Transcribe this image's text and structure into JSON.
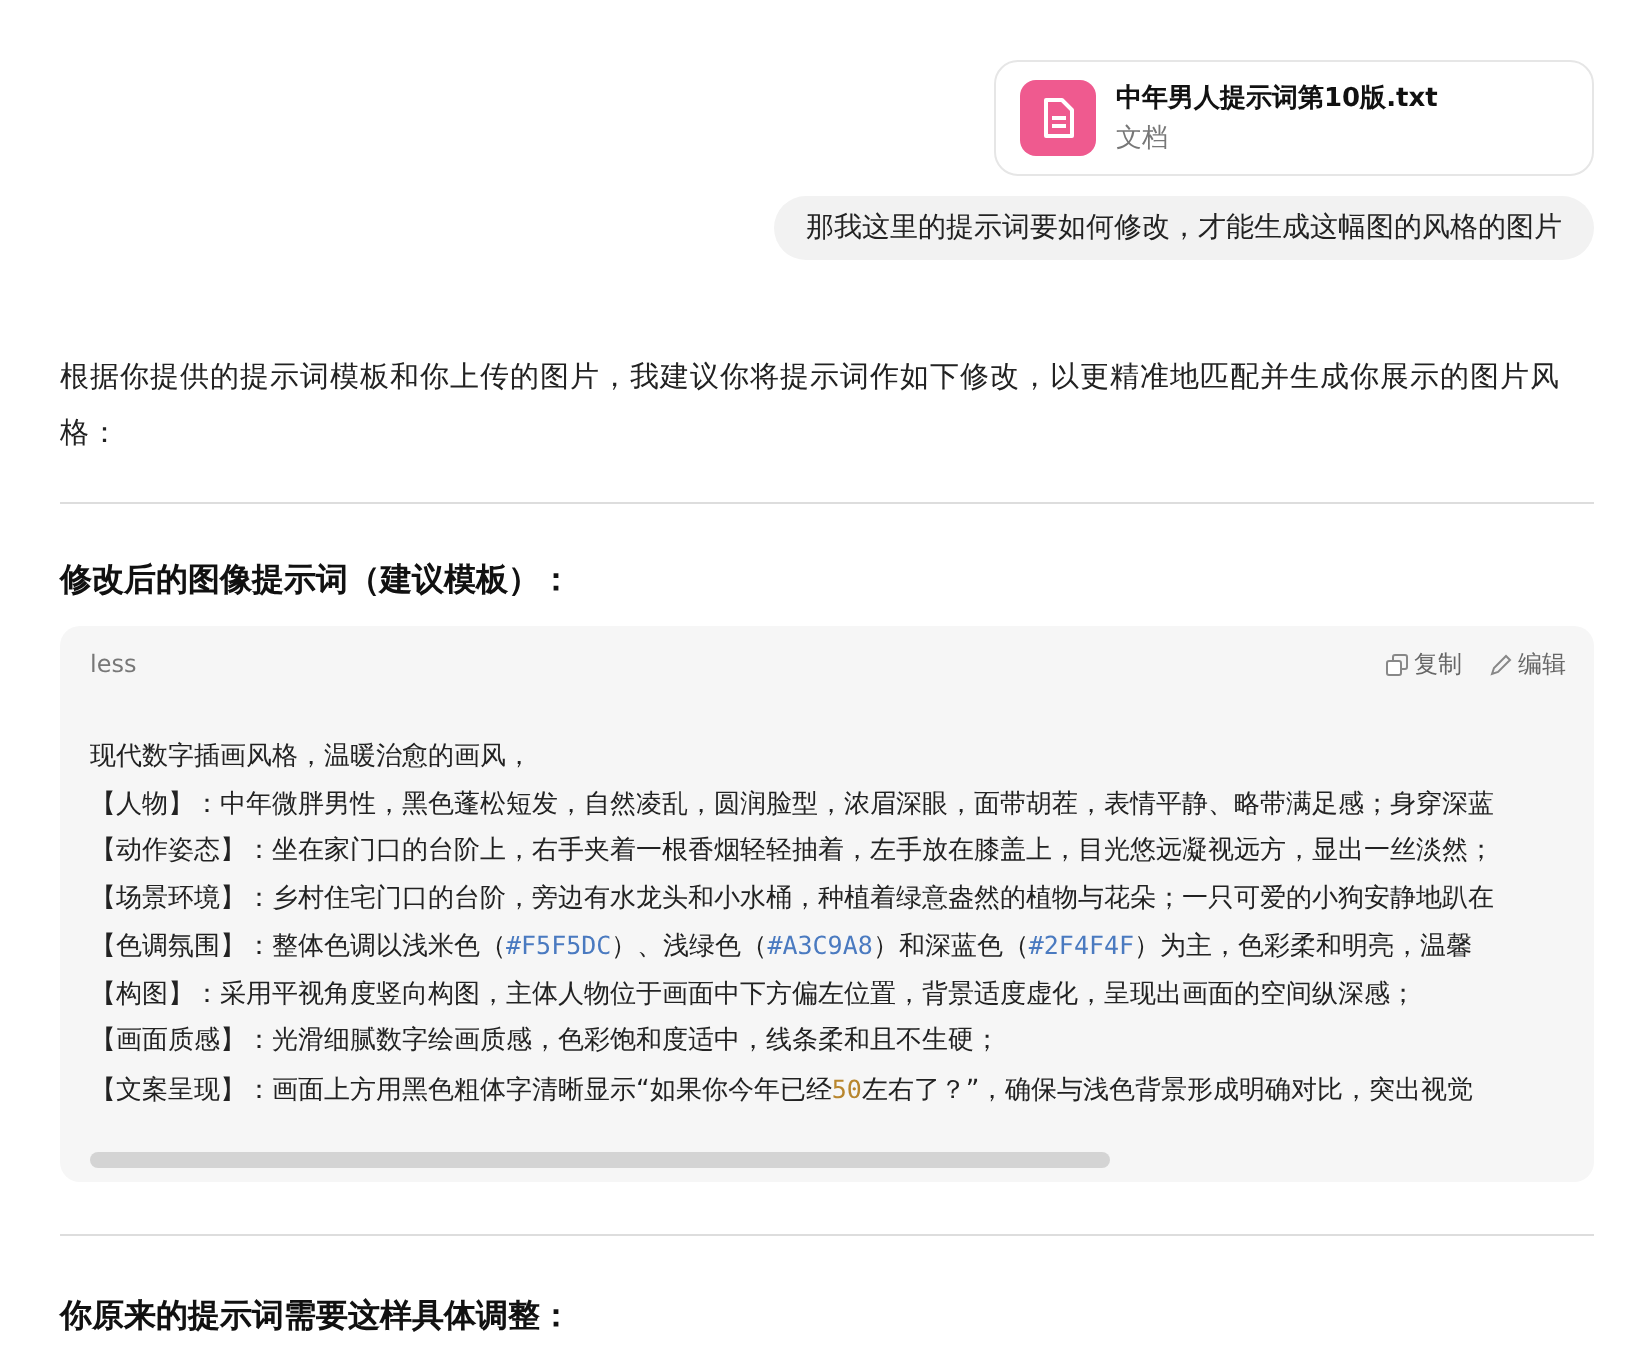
{
  "attachment": {
    "file_name": "中年男人提示词第10版.txt",
    "file_type": "文档"
  },
  "user_message": "那我这里的提示词要如何修改，才能生成这幅图的风格的图片",
  "reply": {
    "intro": "根据你提供的提示词模板和你上传的图片，我建议你将提示词作如下修改，以更精准地匹配并生成你展示的图片风格：",
    "heading": "修改后的图像提示词（建议模板）：",
    "code_block": {
      "language": "less",
      "copy_label": "复制",
      "edit_label": "编辑",
      "lines": [
        [
          {
            "kind": "plain",
            "text": "现代数字插画风格，温暖治愈的画风，"
          }
        ],
        [
          {
            "kind": "plain",
            "text": "【人物】：中年微胖男性，黑色蓬松短发，自然凌乱，圆润脸型，浓眉深眼，面带胡茬，表情平静、略带满足感；身穿深蓝"
          }
        ],
        [
          {
            "kind": "plain",
            "text": "【动作姿态】：坐在家门口的台阶上，右手夹着一根香烟轻轻抽着，左手放在膝盖上，目光悠远凝视远方，显出一丝淡然；"
          }
        ],
        [
          {
            "kind": "plain",
            "text": "【场景环境】：乡村住宅门口的台阶，旁边有水龙头和小水桶，种植着绿意盎然的植物与花朵；一只可爱的小狗安静地趴在"
          }
        ],
        [
          {
            "kind": "plain",
            "text": "【色调氛围】：整体色调以浅米色（"
          },
          {
            "kind": "hex",
            "text": "#F5F5DC"
          },
          {
            "kind": "plain",
            "text": "）、浅绿色（"
          },
          {
            "kind": "hex",
            "text": "#A3C9A8"
          },
          {
            "kind": "plain",
            "text": "）和深蓝色（"
          },
          {
            "kind": "hex",
            "text": "#2F4F4F"
          },
          {
            "kind": "plain",
            "text": "）为主，色彩柔和明亮，温馨"
          }
        ],
        [
          {
            "kind": "plain",
            "text": "【构图】：采用平视角度竖向构图，主体人物位于画面中下方偏左位置，背景适度虚化，呈现出画面的空间纵深感；"
          }
        ],
        [
          {
            "kind": "plain",
            "text": "【画面质感】：光滑细腻数字绘画质感，色彩饱和度适中，线条柔和且不生硬；"
          }
        ],
        [
          {
            "kind": "plain",
            "text": "【文案呈现】：画面上方用黑色粗体字清晰显示“如果你今年已经"
          },
          {
            "kind": "number",
            "text": "50"
          },
          {
            "kind": "plain",
            "text": "左右了？”，确保与浅色背景形成明确对比，突出视觉"
          }
        ]
      ]
    },
    "next_heading": "你原来的提示词需要这样具体调整："
  }
}
